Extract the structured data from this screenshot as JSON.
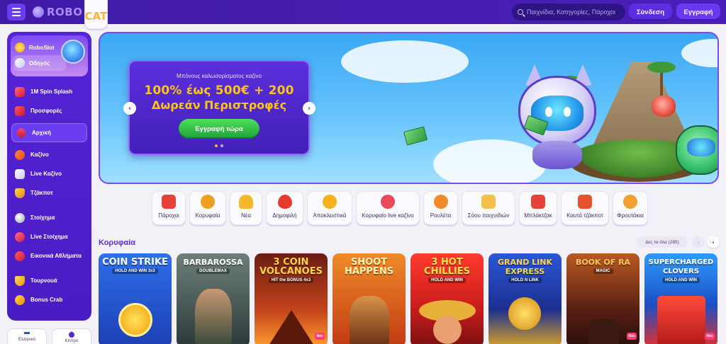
{
  "header": {
    "logo_left": "ROBO",
    "logo_right": "CAT",
    "search_placeholder": "Παιχνίδια, Κατηγορίες, Πάροχοι",
    "login_label": "Σύνδεση",
    "register_label": "Εγγραφή"
  },
  "sidebar": {
    "promo_items": [
      {
        "label": "RoboSlot",
        "icon": "coin-icon"
      },
      {
        "label": "Οδηγός",
        "icon": "guide-icon"
      }
    ],
    "items": [
      {
        "label": "1M Spin Splash",
        "icon": "spin-icon"
      },
      {
        "label": "Προσφορές",
        "icon": "gift-icon"
      },
      {
        "label": "Αρχική",
        "icon": "home-icon"
      },
      {
        "label": "Καζίνο",
        "icon": "slot-icon"
      },
      {
        "label": "Live Καζίνο",
        "icon": "cards-icon"
      },
      {
        "label": "Τζάκποτ",
        "icon": "jackpot-icon"
      },
      {
        "label": "Στοίχημα",
        "icon": "ball-icon"
      },
      {
        "label": "Live Στοίχημα",
        "icon": "live-bet-icon"
      },
      {
        "label": "Εικονικά Αθλήματα",
        "icon": "virtual-sports-icon"
      },
      {
        "label": "Τουρνουά",
        "icon": "trophy-icon"
      },
      {
        "label": "Bonus Crab",
        "icon": "bonus-crab-icon"
      }
    ],
    "active": "Αρχική",
    "language_label": "Ελληνικά",
    "help_label": "Κέντρο"
  },
  "banner": {
    "subtitle": "Μπόνους καλωσορίσματος καζίνο",
    "title_line1": "100% έως 500€ + 200",
    "title_line2": "Δωρεάν Περιστροφές",
    "cta_label": "Εγγραφή τώρα",
    "prev_arrow": "‹",
    "next_arrow": "›"
  },
  "categories": [
    {
      "label": "Πάροχοι",
      "color": "#e8413a"
    },
    {
      "label": "Κορυφαία",
      "color": "#f0a020"
    },
    {
      "label": "Νέα",
      "color": "#f5b82a"
    },
    {
      "label": "Δημοφιλή",
      "color": "#e63a2e"
    },
    {
      "label": "Αποκλειστικά",
      "color": "#f6b21e"
    },
    {
      "label": "Κορυφαίο live καζίνο",
      "color": "#e84a5a"
    },
    {
      "label": "Ρουλέτα",
      "color": "#f08a2a"
    },
    {
      "label": "Σόου παιχνιδιών",
      "color": "#f3c04a"
    },
    {
      "label": "Μπλάκτζακ",
      "color": "#e8413a"
    },
    {
      "label": "Καυτά τζάκποτ",
      "color": "#e8502e"
    },
    {
      "label": "Φρουτάκια",
      "color": "#f2a030"
    }
  ],
  "section": {
    "title": "Κορυφαία",
    "see_all": "Δες τα όλα (285)",
    "prev": "‹",
    "next": "›"
  },
  "games": [
    {
      "title": "COIN STRIKE",
      "subtitle": "HOLD AND WIN 3x3",
      "new": ""
    },
    {
      "title": "BARBAROSSA",
      "subtitle": "DOUBLEMAX",
      "new": ""
    },
    {
      "title": "3 COIN VOLCANOES",
      "subtitle": "HIT the BONUS 4x3",
      "new": "Νέο"
    },
    {
      "title": "SHOOT HAPPENS",
      "subtitle": "",
      "new": ""
    },
    {
      "title": "3 HOT CHILLIES",
      "subtitle": "HOLD AND WIN",
      "new": ""
    },
    {
      "title": "GRAND LINK EXPRESS",
      "subtitle": "HOLD N LINK",
      "new": ""
    },
    {
      "title": "BOOK OF RA",
      "subtitle": "MAGIC",
      "new": "Νέο"
    },
    {
      "title": "SUPERCHARGED CLOVERS",
      "subtitle": "HOLD AND WIN",
      "new": "Νέο"
    }
  ]
}
